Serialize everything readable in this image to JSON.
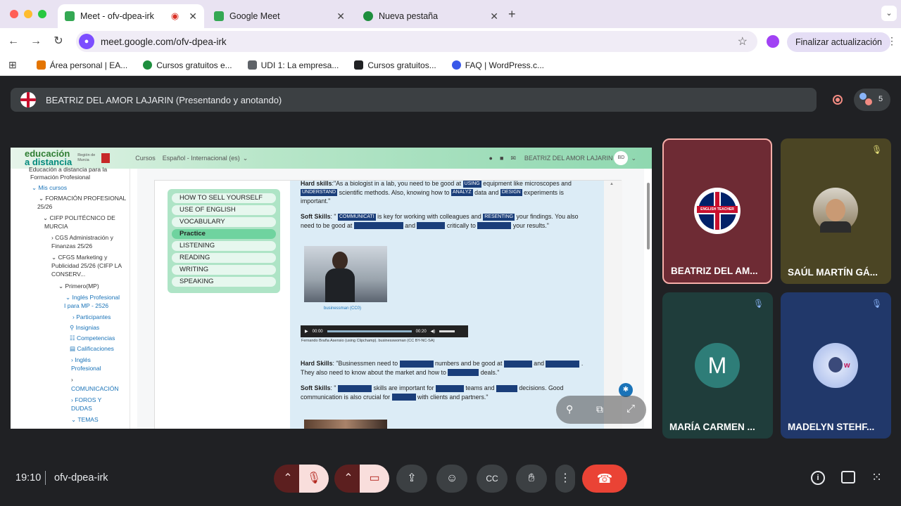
{
  "browser": {
    "tabs": [
      {
        "title": "Meet - ofv-dpea-irk"
      },
      {
        "title": "Google Meet"
      },
      {
        "title": "Nueva pestaña"
      }
    ],
    "url": "meet.google.com/ofv-dpea-irk",
    "update_label": "Finalizar actualización",
    "bookmarks": [
      "Área personal | EA...",
      "Cursos gratuitos e...",
      "UDI 1: La empresa...",
      "Cursos gratuitos...",
      "FAQ | WordPress.c..."
    ]
  },
  "meet": {
    "presenter_banner": "BEATRIZ DEL AMOR LAJARIN (Presentando y anotando)",
    "participant_count": "5",
    "time": "19:10",
    "meeting_code": "ofv-dpea-irk",
    "tiles": [
      {
        "name": "BEATRIZ DEL AM...",
        "badge": "ENGLISH TEACHER"
      },
      {
        "name": "SAÚL MARTÍN GÁ..."
      },
      {
        "name": "MARÍA CARMEN ...",
        "initial": "M"
      },
      {
        "name": "MADELYN STEHF..."
      }
    ]
  },
  "shared": {
    "logo_line1": "educación",
    "logo_line2": "a distancia",
    "region": "Región de Murcia",
    "nav": [
      "Cursos",
      "Español - Internacional (es)"
    ],
    "user": "BEATRIZ DEL AMOR LAJARIN",
    "user_initials": "BD",
    "sidebar": [
      "Educación a distancia para la",
      "Formación Profesional",
      "Mis cursos",
      "FORMACIÓN PROFESIONAL",
      "25/26",
      "CIFP POLITÉCNICO DE",
      "MURCIA",
      "CGS Administración y",
      "Finanzas 25/26",
      "CFGS Marketing y",
      "Publicidad 25/26 (CIFP LA",
      "CONSERV...",
      "Primero(MP)",
      "Inglés Profesional",
      "I para MP - 2526",
      "Participantes",
      "Insignias",
      "Competencias",
      "Calificaciones",
      "Inglés",
      "Profesional",
      "COMUNICACIÓN",
      "FOROS Y",
      "DUDAS",
      "TEMAS"
    ],
    "menu": [
      "HOW TO SELL YOURSELF",
      "USE OF ENGLISH",
      "VOCABULARY",
      "Practice",
      "LISTENING",
      "READING",
      "WRITING",
      "SPEAKING"
    ],
    "exercise": {
      "hard1_label": "Hard skills",
      "hard1_a": ":\"As a biologist in a lab, you need to be good at",
      "w_using": "USING",
      "hard1_b": "equipment like microscopes and",
      "w_understand": "UNDERSTAND",
      "hard1_c": "scientific methods. Also, knowing how to",
      "w_analyz": "ANALYZ",
      "hard1_d": "data and",
      "w_design": "DESIGN",
      "hard1_e": "experiments is important.\"",
      "soft1_label": "Soft Skills",
      "soft1_a": ": \"",
      "w_communicat": "COMMUNICATI",
      "soft1_b": "is key for working with colleagues and",
      "w_presenting": "RESENTING",
      "soft1_c": "your findings. You also need to be good at",
      "soft1_d": "and",
      "soft1_e": "critically to",
      "soft1_f": "your results.\"",
      "img_caption": "businessman (CC0)",
      "audio_start": "00:00",
      "audio_end": "00:20",
      "audio_credit": "Fernando Braña Asensio (using Clipchamp). businesswoman (CC BY-NC-SA)",
      "hard2_label": "Hard Skills",
      "hard2_a": ": \"Businessmen need to",
      "hard2_b": "numbers and be good at",
      "hard2_c": "and",
      "hard2_d": ". They also need to know about the market and how to",
      "hard2_e": "deals.\"",
      "soft2_label": "Soft Skills",
      "soft2_a": ": \"",
      "soft2_b": "skills are important for",
      "soft2_c": "teams and",
      "soft2_d": "decisions. Good communication is also crucial for",
      "soft2_e": "with clients and partners.\""
    }
  },
  "colors": {
    "meet_bg": "#202124",
    "end_call": "#ea4335",
    "menu_green": "#aee4c6",
    "exercise_bg": "#dcecf6"
  }
}
